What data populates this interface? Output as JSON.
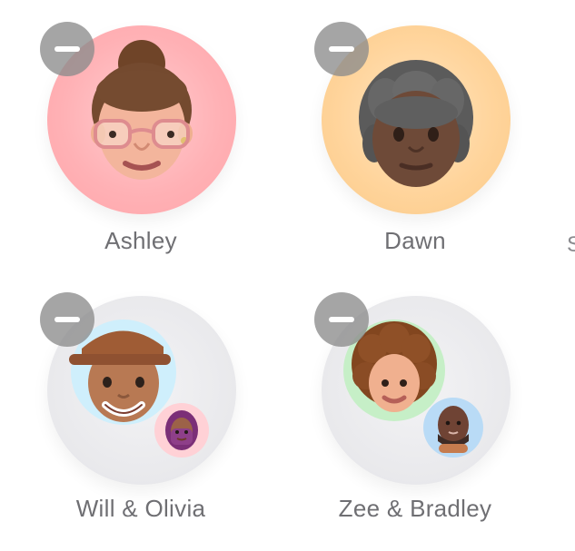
{
  "contacts": [
    {
      "name": "Ashley",
      "avatar_icon": "memoji-woman-bun-glasses-icon",
      "ring_color": "#ffb1b5"
    },
    {
      "name": "Dawn",
      "avatar_icon": "memoji-older-woman-gray-hair-icon",
      "ring_color": "#ffd49b"
    },
    {
      "name": "Will & Olivia",
      "avatar_icon": "memoji-man-cap-icon",
      "secondary_icon": "memoji-girl-purple-hair-icon",
      "ring_color": "#e9e9ec"
    },
    {
      "name": "Zee & Bradley",
      "avatar_icon": "memoji-curly-hair-icon",
      "secondary_icon": "memoji-bald-man-beard-icon",
      "ring_color": "#e9e9ec"
    }
  ],
  "remove_icon": "minus-icon",
  "edge_hint": "S"
}
